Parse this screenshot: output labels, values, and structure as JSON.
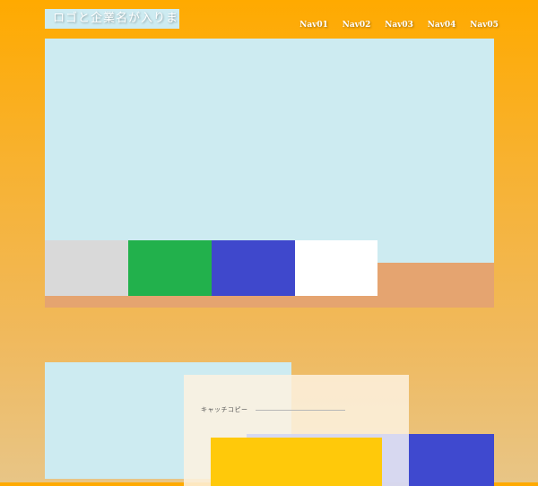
{
  "header": {
    "logo_text": "ロゴと企業名が入ります",
    "nav": [
      "Nav01",
      "Nav02",
      "Nav03",
      "Nav04",
      "Nav05"
    ]
  },
  "hero": {
    "background_color": "#cdebf1",
    "bottom_band_color": "#e5a470",
    "slider_tabs": [
      {
        "color": "#d9d9d9"
      },
      {
        "color": "#22b14c"
      },
      {
        "color": "#3f48cc"
      },
      {
        "color": "#ffffff"
      }
    ]
  },
  "section": {
    "catch_copy": "キャッチコピー",
    "colors": {
      "image_placeholder": "#cdebf1",
      "card": "#fdf2e0",
      "accent_yellow": "#ffc90a",
      "accent_blue": "#3f49cf",
      "accent_lavender": "#d2d5f4"
    }
  }
}
